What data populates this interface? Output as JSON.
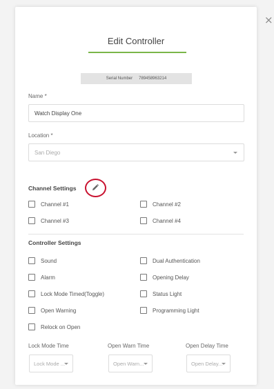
{
  "dialog": {
    "title": "Edit Controller",
    "close_glyph": "×",
    "accent_color": "#7ab648",
    "highlight_color": "#c8102e"
  },
  "serial": {
    "label": "Serial Number",
    "value": "789458963214"
  },
  "name_field": {
    "label": "Name *",
    "value": "Watch Display One"
  },
  "location_field": {
    "label": "Location *",
    "value": "San Diego"
  },
  "channel_settings": {
    "title": "Channel Settings",
    "edit_icon": "pencil-icon",
    "channels": [
      {
        "label": "Channel #1",
        "checked": false
      },
      {
        "label": "Channel #2",
        "checked": false
      },
      {
        "label": "Channel #3",
        "checked": false
      },
      {
        "label": "Channel #4",
        "checked": false
      }
    ]
  },
  "controller_settings": {
    "title": "Controller Settings",
    "options": [
      {
        "label": "Sound",
        "checked": false
      },
      {
        "label": "Dual Authentication",
        "checked": false
      },
      {
        "label": "Alarm",
        "checked": false
      },
      {
        "label": "Opening Delay",
        "checked": false
      },
      {
        "label": "Lock Mode Timed(Toggle)",
        "checked": false
      },
      {
        "label": "Status Light",
        "checked": false
      },
      {
        "label": "Open Warning",
        "checked": false
      },
      {
        "label": "Programming Light",
        "checked": false
      },
      {
        "label": "Relock on Open",
        "checked": false
      }
    ]
  },
  "timers": [
    {
      "label": "Lock Mode Time",
      "placeholder": "Lock Mode ..."
    },
    {
      "label": "Open Warn Time",
      "placeholder": "Open Warn..."
    },
    {
      "label": "Open Delay Time",
      "placeholder": "Open Delay..."
    }
  ]
}
